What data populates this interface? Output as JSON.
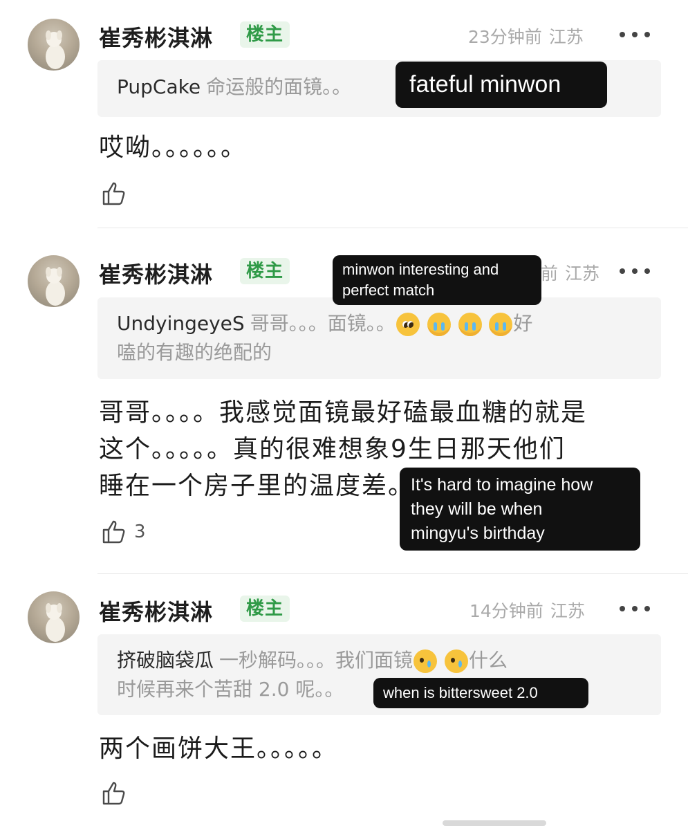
{
  "comments": [
    {
      "username": "崔秀彬淇淋",
      "badge": "楼主",
      "time": "23分钟前",
      "location": "江苏",
      "quote_author": "PupCake",
      "quote_text": "命运般的面镜。。",
      "reply_text": "哎呦。。。。。。",
      "likes": ""
    },
    {
      "username": "崔秀彬淇淋",
      "badge": "楼主",
      "time": "前",
      "location": "江苏",
      "quote_author": "UndyingeyeS",
      "quote_text_1": "哥哥。。。面镜。。",
      "quote_text_2": "好",
      "quote_text_3": "嗑的有趣的绝配的",
      "emojis": [
        "pleading-face-emoji",
        "loudly-crying-face-emoji",
        "loudly-crying-face-emoji",
        "loudly-crying-face-emoji"
      ],
      "reply_text": "哥哥。。。。我感觉面镜最好磕最血糖的就是\n这个。。。。。真的很难想象9生日那天他们\n睡在一个房子里的温度差。",
      "likes": "3"
    },
    {
      "username": "崔秀彬淇淋",
      "badge": "楼主",
      "time": "14分钟前",
      "location": "江苏",
      "quote_author": "挤破脑袋瓜",
      "quote_text_1": "一秒解码。。。我们面镜",
      "quote_text_2": "什么",
      "quote_text_3": "时候再来个苦甜 2.0 呢。。",
      "emojis": [
        "smiling-face-with-tear-emoji",
        "smiling-face-with-tear-emoji"
      ],
      "reply_text": "两个画饼大王。。。。。",
      "likes": ""
    }
  ],
  "subtitles": {
    "s1": "fateful minwon",
    "s2": "minwon  interesting and\nperfect match",
    "s3": "It's hard to imagine how\nthey will be when\nmingyu's birthday",
    "s4": "when is bittersweet 2.0"
  },
  "colors": {
    "badge_bg": "#e9f5ea",
    "badge_text": "#2f9a47",
    "meta_text": "#a9a9a9",
    "quote_bg": "#f4f4f4",
    "subtitle_bg": "#111111"
  }
}
